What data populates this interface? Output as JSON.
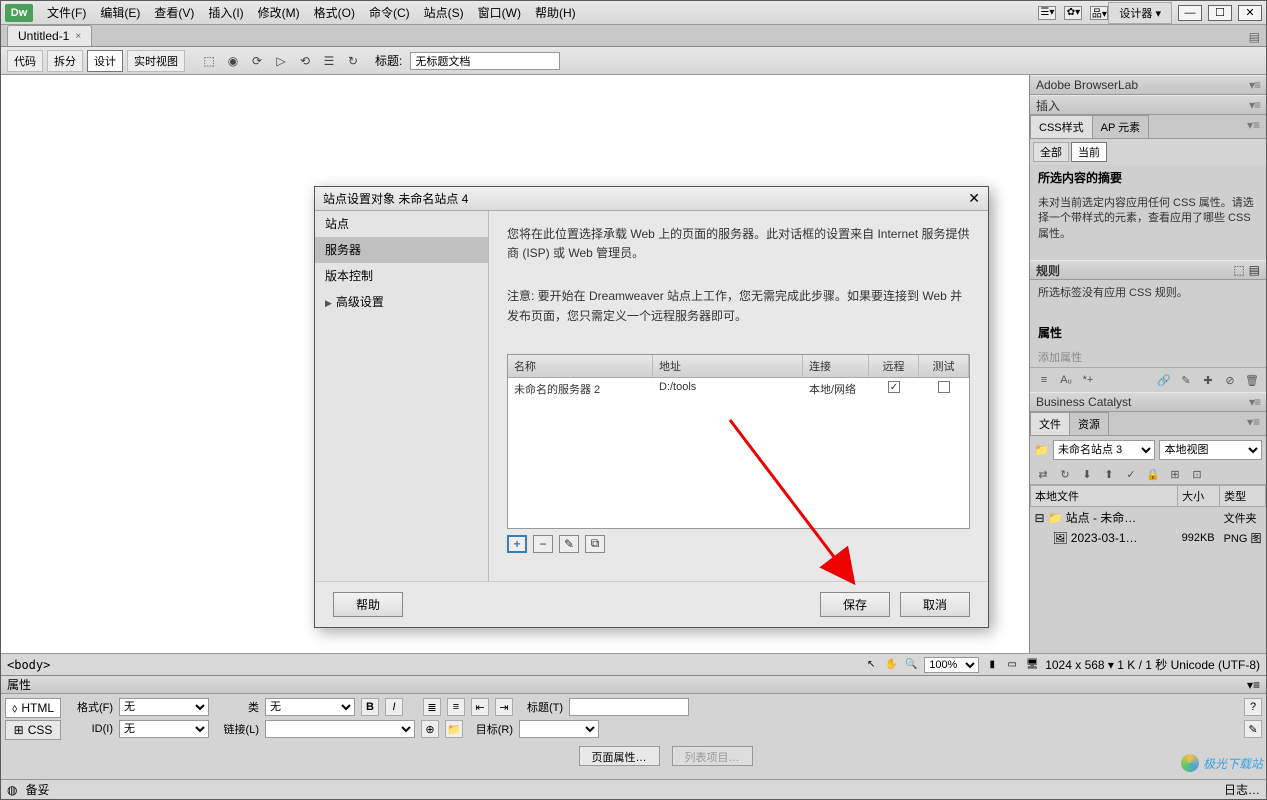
{
  "app": {
    "logo": "Dw"
  },
  "menus": [
    "文件(F)",
    "编辑(E)",
    "查看(V)",
    "插入(I)",
    "修改(M)",
    "格式(O)",
    "命令(C)",
    "站点(S)",
    "窗口(W)",
    "帮助(H)"
  ],
  "title_right": {
    "designer": "设计器 ▾",
    "min": "—",
    "max": "☐",
    "close": "✕"
  },
  "doctab": {
    "name": "Untitled-1",
    "close": "×"
  },
  "toolbar": {
    "code": "代码",
    "split": "拆分",
    "design": "设计",
    "live": "实时视图",
    "title_label": "标题:",
    "title_value": "无标题文档"
  },
  "panels": {
    "browserlab": "Adobe BrowserLab",
    "insert": "插入",
    "css_tab": "CSS样式",
    "ap_tab": "AP 元素",
    "all": "全部",
    "current": "当前",
    "summary_title": "所选内容的摘要",
    "summary_text": "未对当前选定内容应用任何 CSS 属性。请选择一个带样式的元素，查看应用了哪些 CSS 属性。",
    "rules_title": "规则",
    "rules_text": "所选标签没有应用 CSS 规则。",
    "props_title": "属性",
    "add_prop": "添加属性",
    "bc": "Business Catalyst",
    "files_tab": "文件",
    "assets_tab": "资源",
    "site_sel": "未命名站点 3",
    "view_sel": "本地视图",
    "ft_head": {
      "file": "本地文件",
      "size": "大小",
      "type": "类型"
    },
    "ft_rows": [
      {
        "icon": "📁",
        "name": "站点 - 未命…",
        "size": "",
        "type": "文件夹"
      },
      {
        "icon": "🖼",
        "name": "2023-03-1…",
        "size": "992KB",
        "type": "PNG 图"
      }
    ]
  },
  "status": {
    "tag": "<body>",
    "zoom": "100%",
    "dims": "1024 x 568 ▾ 1 K / 1 秒 Unicode (UTF-8)"
  },
  "props": {
    "header": "属性",
    "html_btn": "HTML",
    "css_btn": "CSS",
    "format_l": "格式(F)",
    "format_v": "无",
    "class_l": "类",
    "class_v": "无",
    "id_l": "ID(I)",
    "id_v": "无",
    "link_l": "链接(L)",
    "link_v": "",
    "b": "B",
    "i": "I",
    "title_l": "标题(T)",
    "target_l": "目标(R)",
    "pageprops": "页面属性…",
    "listitem": "列表项目…"
  },
  "logbar": {
    "ready": "备妥",
    "log": "日志…"
  },
  "dialog": {
    "title": "站点设置对象 未命名站点 4",
    "side": [
      "站点",
      "服务器",
      "版本控制",
      "高级设置"
    ],
    "desc1": "您将在此位置选择承载 Web 上的页面的服务器。此对话框的设置来自 Internet 服务提供商 (ISP) 或 Web 管理员。",
    "note": "注意: 要开始在 Dreamweaver 站点上工作，您无需完成此步骤。如果要连接到 Web 并发布页面，您只需定义一个远程服务器即可。",
    "cols": {
      "name": "名称",
      "addr": "地址",
      "conn": "连接",
      "remote": "远程",
      "test": "测试"
    },
    "row": {
      "name": "未命名的服务器 2",
      "addr": "D:/tools",
      "conn": "本地/网络",
      "remote": "✓",
      "test": ""
    },
    "tools": {
      "plus": "+",
      "minus": "−",
      "edit": "✎",
      "dup": "⧉"
    },
    "help": "帮助",
    "save": "保存",
    "cancel": "取消"
  },
  "watermark": "极光下载站"
}
